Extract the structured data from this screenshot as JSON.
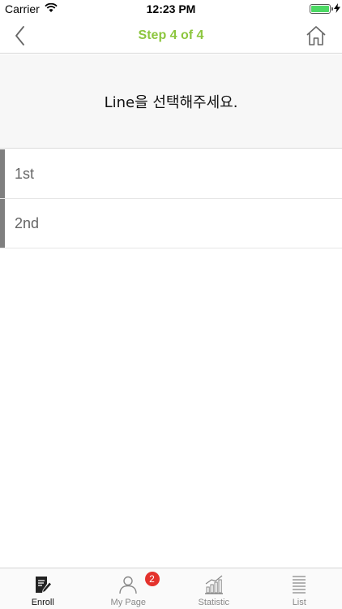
{
  "status_bar": {
    "carrier": "Carrier",
    "time": "12:23 PM",
    "battery_level": 1.0
  },
  "nav_bar": {
    "title": "Step 4 of 4",
    "back_icon": "chevron-left-icon",
    "home_icon": "home-icon"
  },
  "prompt": {
    "text": "Line을 선택해주세요."
  },
  "lines": [
    {
      "label": "1st"
    },
    {
      "label": "2nd"
    }
  ],
  "tab_bar": {
    "tabs": [
      {
        "label": "Enroll",
        "icon": "enroll-edit-icon",
        "active": true
      },
      {
        "label": "My Page",
        "icon": "person-icon",
        "badge": "2"
      },
      {
        "label": "Statistic",
        "icon": "chart-icon"
      },
      {
        "label": "List",
        "icon": "list-icon"
      }
    ]
  },
  "colors": {
    "accent": "#8cc63e",
    "badge": "#e4322d",
    "line_marker": "#7f7f7f"
  }
}
